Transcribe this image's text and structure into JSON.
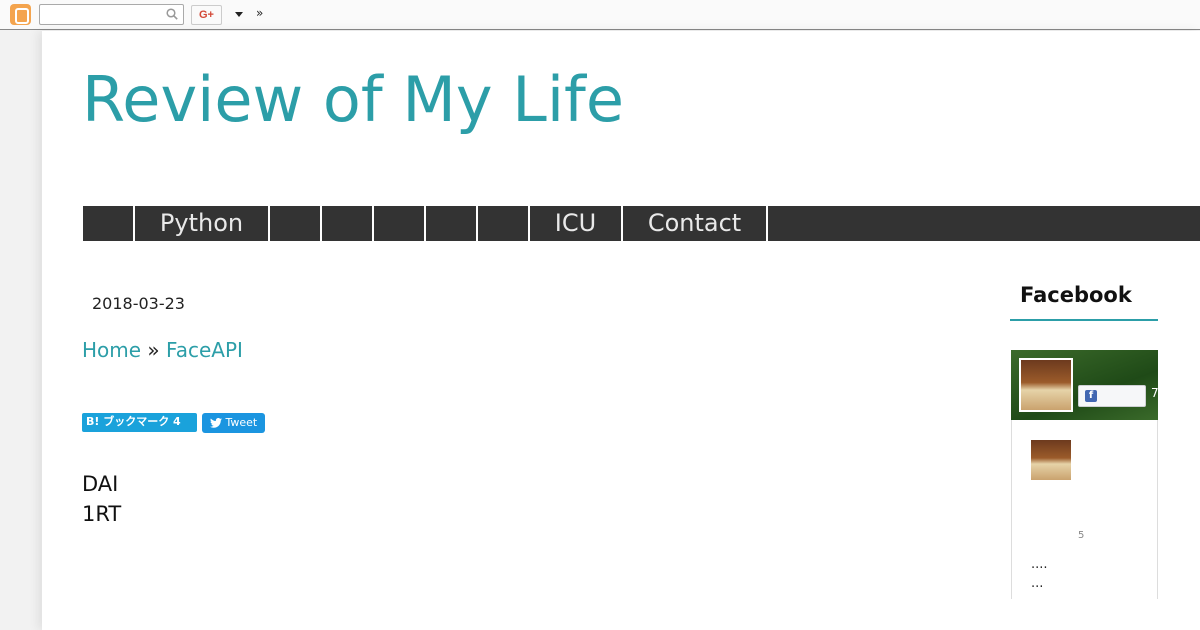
{
  "navbar": {
    "search_placeholder": "",
    "gplus_label": "G+",
    "more_label": "»"
  },
  "blog": {
    "title": "Review of My Life"
  },
  "menu": {
    "items": [
      {
        "label": ""
      },
      {
        "label": "Python"
      },
      {
        "label": ""
      },
      {
        "label": ""
      },
      {
        "label": ""
      },
      {
        "label": ""
      },
      {
        "label": ""
      },
      {
        "label": "ICU"
      },
      {
        "label": "Contact"
      }
    ]
  },
  "post": {
    "date": "2018-03-23",
    "breadcrumb": {
      "home": "Home",
      "separator": "»",
      "current": "FaceAPI"
    },
    "share": {
      "hatena_label": "B! ブックマーク 4",
      "tweet_label": "Tweet"
    },
    "body_lines": [
      "DAI",
      "1RT"
    ]
  },
  "sidebar": {
    "facebook": {
      "heading": "Facebook",
      "like_count_fragment": "7",
      "number": "5",
      "line1": "....",
      "line2": "..."
    }
  },
  "colors": {
    "accent": "#2c9ea8",
    "menu_bg": "#333333",
    "hatena": "#1aa2db",
    "twitter": "#1b95e0",
    "facebook": "#4267b2"
  }
}
